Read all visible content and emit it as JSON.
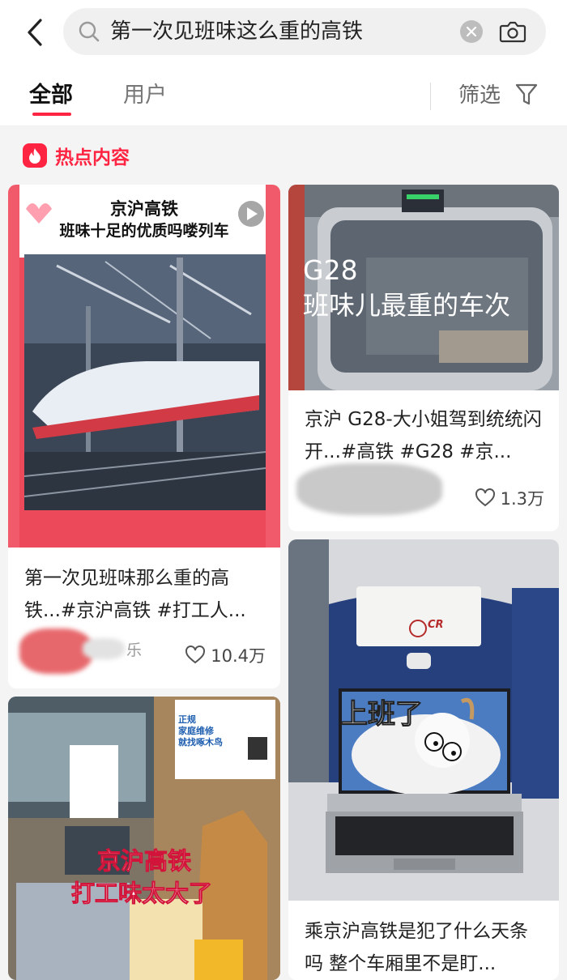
{
  "search": {
    "query": "第一次见班味这么重的高铁"
  },
  "tabs": {
    "all": "全部",
    "users": "用户",
    "filter": "筛选"
  },
  "section": {
    "hot_label": "热点内容"
  },
  "cards": [
    {
      "cover_title_line1": "京沪高铁",
      "cover_title_line2": "班味十足的优质吗喽列车",
      "title": "第一次见班味那么重的高铁...#京沪高铁 #打工人...",
      "author_fragment": "乐",
      "likes": "10.4万"
    },
    {
      "cover_line1": "G28",
      "cover_line2": "班味儿最重的车次",
      "title": "京沪 G28-大小姐驾到统统闪开...#高铁 #G28 #京...",
      "likes": "1.3万"
    },
    {
      "cover_line1": "京沪高铁",
      "cover_line2": "打工味太大了",
      "poster_line1": "正规",
      "poster_line2": "家庭维修",
      "poster_line3": "就找啄木鸟"
    },
    {
      "cover_caption": "上班了",
      "headrest_logo": "CR",
      "title": "乘京沪高铁是犯了什么天条吗 整个车厢里不是盯..."
    }
  ],
  "colors": {
    "accent": "#ff2442"
  },
  "icons": [
    "back-arrow-icon",
    "search-icon",
    "clear-icon",
    "camera-icon",
    "filter-funnel-icon",
    "flame-icon",
    "play-icon",
    "heart-icon"
  ]
}
